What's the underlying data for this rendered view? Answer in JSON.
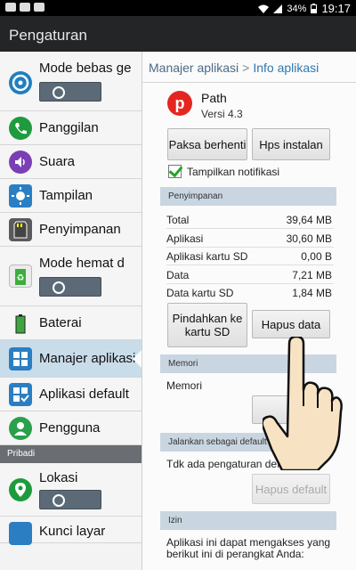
{
  "status_bar": {
    "battery": "34%",
    "time": "19:17"
  },
  "title_bar": {
    "title": "Pengaturan"
  },
  "sidebar": {
    "items": [
      {
        "label": "Mode bebas ge",
        "icon": "steering-wheel-icon"
      },
      {
        "label": "Panggilan",
        "icon": "phone-icon"
      },
      {
        "label": "Suara",
        "icon": "speaker-icon"
      },
      {
        "label": "Tampilan",
        "icon": "brightness-icon"
      },
      {
        "label": "Penyimpanan",
        "icon": "sd-card-icon"
      },
      {
        "label": "Mode hemat d",
        "icon": "recycle-battery-icon"
      },
      {
        "label": "Baterai",
        "icon": "battery-icon"
      },
      {
        "label": "Manajer aplikasi",
        "icon": "grid-icon"
      },
      {
        "label": "Aplikasi default",
        "icon": "grid-check-icon"
      },
      {
        "label": "Pengguna",
        "icon": "user-icon"
      },
      {
        "label": "Lokasi",
        "icon": "location-pin-icon"
      },
      {
        "label": "Kunci layar",
        "icon": "lock-icon"
      }
    ],
    "header_pribadi": "Pribadi"
  },
  "breadcrumb": {
    "parent": "Manajer aplikasi",
    "separator": ">",
    "current": "Info aplikasi"
  },
  "app": {
    "name": "Path",
    "version": "Versi 4.3",
    "icon_letter": "p"
  },
  "buttons": {
    "force_stop": "Paksa berhenti",
    "uninstall": "Hps instalan",
    "move_sd": "Pindahkan ke kartu SD",
    "clear_data": "Hapus data",
    "clear_default": "Hapus default"
  },
  "notifications": {
    "label": "Tampilkan notifikasi",
    "checked": true
  },
  "storage": {
    "header": "Penyimpanan",
    "rows": [
      {
        "label": "Total",
        "value": "39,64 MB"
      },
      {
        "label": "Aplikasi",
        "value": "30,60 MB"
      },
      {
        "label": "Aplikasi kartu SD",
        "value": "0,00 B"
      },
      {
        "label": "Data",
        "value": "7,21 MB"
      },
      {
        "label": "Data kartu SD",
        "value": "1,84 MB"
      }
    ]
  },
  "memory": {
    "header": "Memori",
    "label": "Memori"
  },
  "launch_default": {
    "header": "Jalankan sebagai default",
    "text": "Tdk ada pengaturan default."
  },
  "permissions": {
    "header": "Izin",
    "text": "Aplikasi ini dapat mengakses yang berikut ini di perangkat Anda:"
  }
}
